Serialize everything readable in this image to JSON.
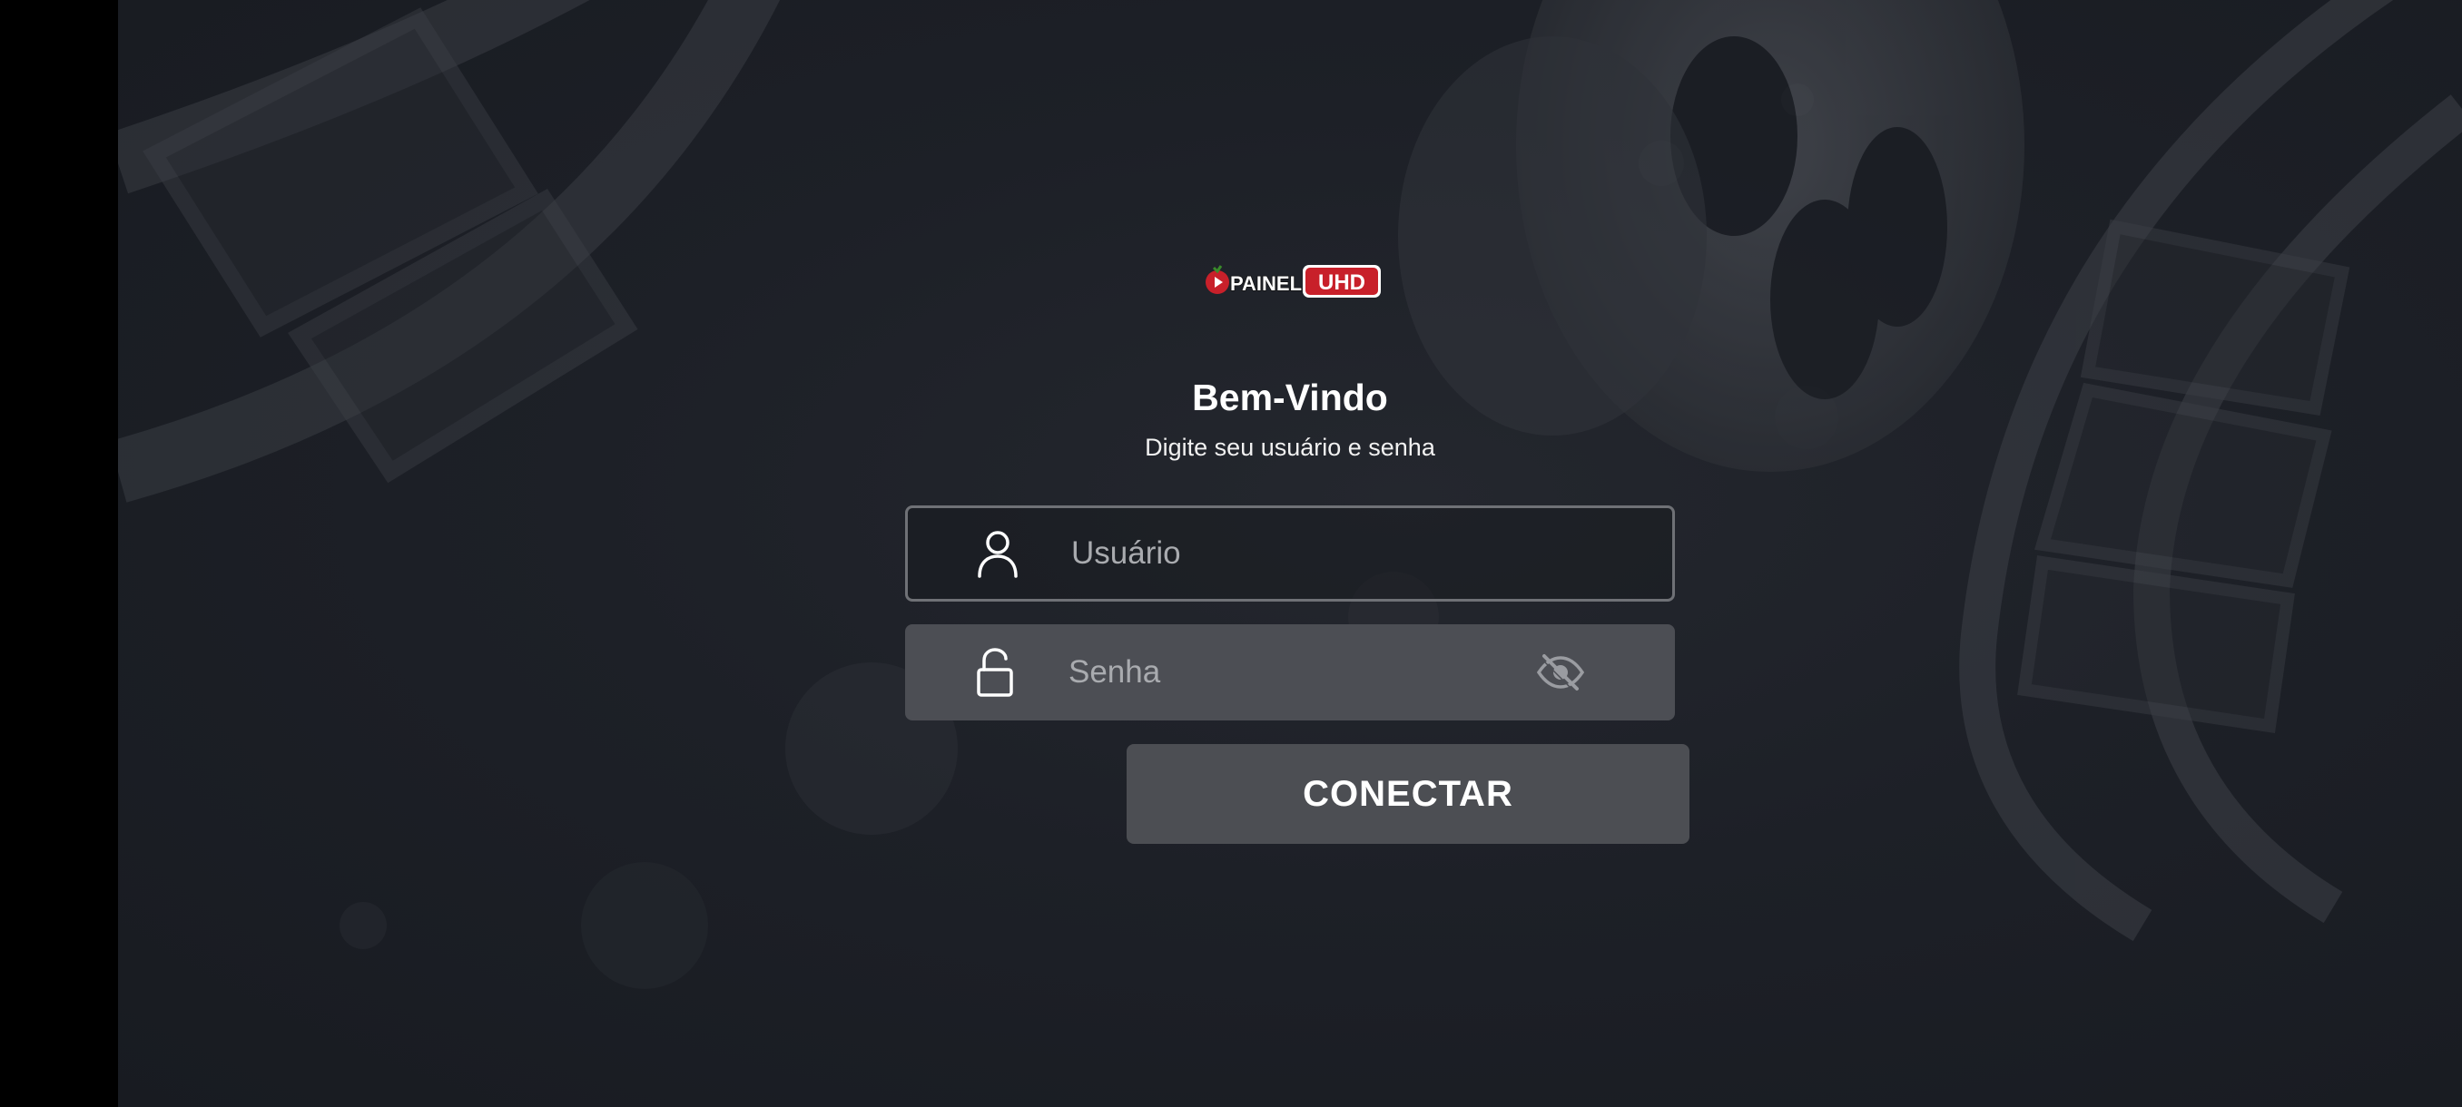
{
  "app": {
    "logo_text_left": "PAINEL",
    "logo_text_right": "UHD"
  },
  "login": {
    "title": "Bem-Vindo",
    "subtitle": "Digite seu usuário e senha",
    "username_placeholder": "Usuário",
    "username_value": "",
    "password_placeholder": "Senha",
    "password_value": "",
    "connect_label": "CONECTAR"
  },
  "icons": {
    "user_field": "user-icon",
    "password_field": "unlock-icon",
    "password_visibility": "eye-off-icon"
  },
  "colors": {
    "background": "#1d2027",
    "field_filled": "#4c4e54",
    "button": "#4c4e53",
    "text": "#ffffff",
    "placeholder": "#a9abaf",
    "logo_red": "#c8202a"
  }
}
